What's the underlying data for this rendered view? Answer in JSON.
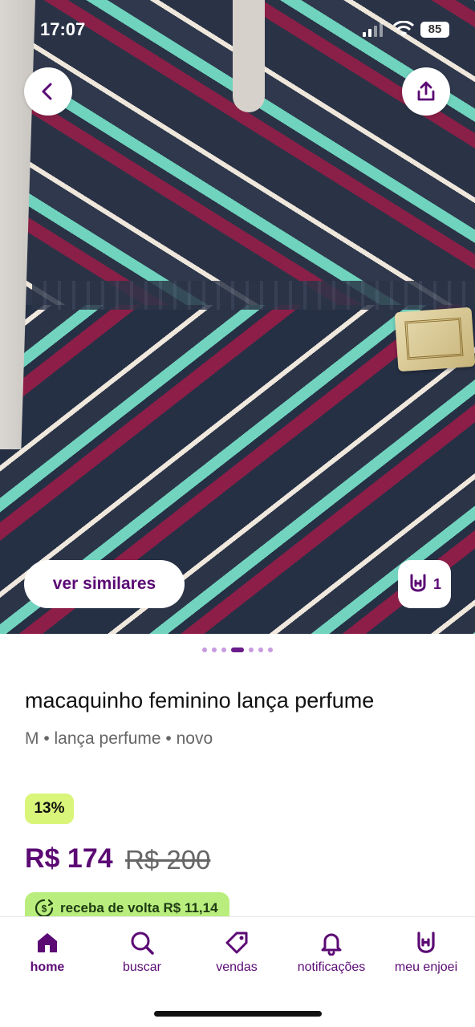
{
  "status_bar": {
    "time": "17:07",
    "battery": "85"
  },
  "product": {
    "title": "macaquinho feminino lança perfume",
    "details": "M • lança perfume • novo",
    "discount_badge": "13%",
    "price": "R$ 174",
    "original_price": "R$ 200",
    "cashback": "receba de volta R$ 11,14"
  },
  "gallery": {
    "similar_button": "ver similares",
    "like_count": "1",
    "page_count": 7,
    "active_page": 4
  },
  "tabbar": {
    "items": [
      {
        "label": "home",
        "icon": "home-icon",
        "active": true
      },
      {
        "label": "buscar",
        "icon": "search-icon",
        "active": false
      },
      {
        "label": "vendas",
        "icon": "tag-icon",
        "active": false
      },
      {
        "label": "notificações",
        "icon": "bell-icon",
        "active": false
      },
      {
        "label": "meu enjoei",
        "icon": "rock-hand-icon",
        "active": false
      }
    ]
  },
  "colors": {
    "brand": "#5b0a74",
    "discount_bg": "#d9f57a",
    "cashback_bg": "#b9ee7e"
  }
}
